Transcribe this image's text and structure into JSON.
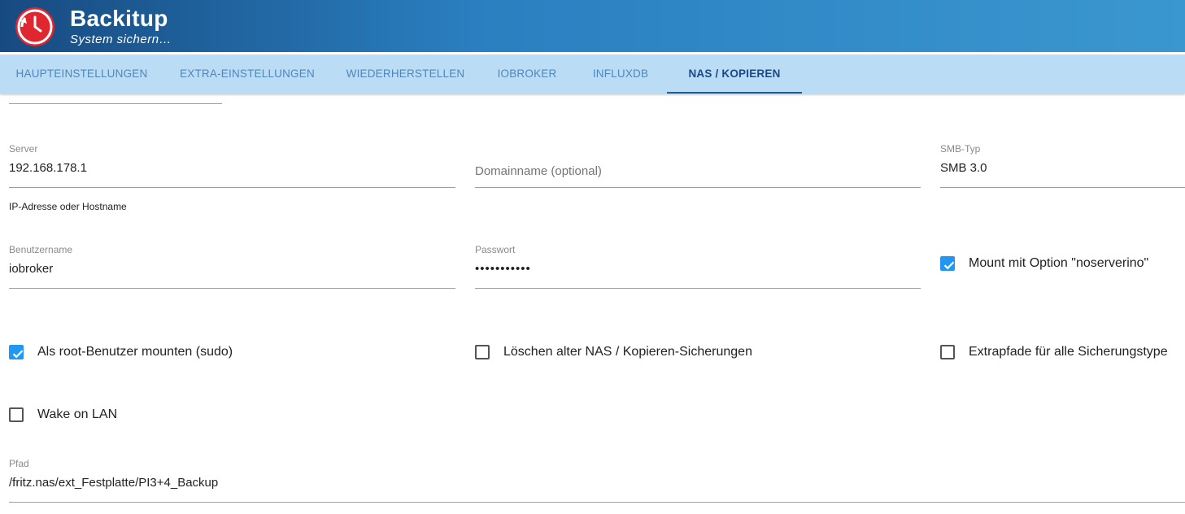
{
  "app": {
    "title": "Backitup",
    "subtitle": "System sichern…",
    "logo_icon": "restore-clock-icon",
    "brand_color": "#e0262f"
  },
  "tabs": [
    {
      "label": "HAUPTEINSTELLUNGEN",
      "active": false
    },
    {
      "label": "EXTRA-EINSTELLUNGEN",
      "active": false
    },
    {
      "label": "WIEDERHERSTELLEN",
      "active": false
    },
    {
      "label": "IOBROKER",
      "active": false
    },
    {
      "label": "INFLUXDB",
      "active": false
    },
    {
      "label": "NAS / KOPIEREN",
      "active": true
    }
  ],
  "form": {
    "server": {
      "label": "Server",
      "value": "192.168.178.1",
      "helper": "IP-Adresse oder Hostname"
    },
    "domain": {
      "placeholder": "Domainname (optional)",
      "value": ""
    },
    "smb": {
      "label": "SMB-Typ",
      "value": "SMB 3.0"
    },
    "username": {
      "label": "Benutzername",
      "value": "iobroker"
    },
    "password": {
      "label": "Passwort",
      "value": "•••••••••••"
    },
    "path": {
      "label": "Pfad",
      "value": "/fritz.nas/ext_Festplatte/PI3+4_Backup"
    }
  },
  "checkboxes": {
    "noserverino": {
      "label": "Mount mit Option \"noserverino\"",
      "checked": true
    },
    "sudo": {
      "label": "Als root-Benutzer mounten (sudo)",
      "checked": true
    },
    "delete_old": {
      "label": "Löschen alter NAS / Kopieren-Sicherungen",
      "checked": false
    },
    "extra_paths": {
      "label": "Extrapfade für alle Sicherungstype",
      "checked": false
    },
    "wake_on_lan": {
      "label": "Wake on LAN",
      "checked": false
    }
  },
  "colors": {
    "accent": "#2196f3",
    "tab_bar": "#bbdcf5",
    "tab_active": "#1a4a86"
  }
}
